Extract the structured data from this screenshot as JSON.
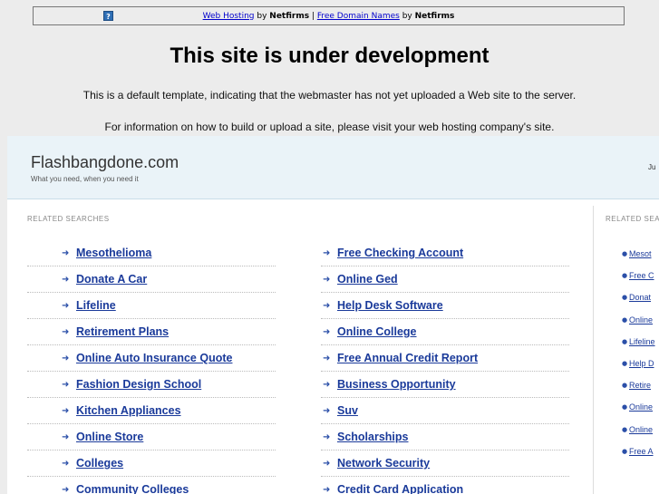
{
  "topbar": {
    "help_icon": "?",
    "link1": "Web Hosting",
    "by1": " by ",
    "brand1": "Netfirms",
    "sep": " | ",
    "link2": "Free Domain Names",
    "by2": " by ",
    "brand2": "Netfirms"
  },
  "title": "This site is under development",
  "line1": "This is a default template, indicating that the webmaster has not yet uploaded a Web site to the server.",
  "line2": "For information on how to build or upload a site, please visit your web hosting company's site.",
  "header": {
    "brand": "Flashbangdone.com",
    "tagline": "What you need, when you need it",
    "right_text": "Ju"
  },
  "related_label": "RELATED SEARCHES",
  "related_label_right": "RELATED SEA",
  "col1": [
    "Mesothelioma",
    "Donate A Car",
    "Lifeline",
    "Retirement Plans",
    "Online Auto Insurance Quote",
    "Fashion Design School",
    "Kitchen Appliances",
    "Online Store",
    "Colleges",
    "Community Colleges"
  ],
  "col2": [
    "Free Checking Account",
    "Online Ged",
    "Help Desk Software",
    "Online College",
    "Free Annual Credit Report",
    "Business Opportunity",
    "Suv",
    "Scholarships",
    "Network Security",
    "Credit Card Application"
  ],
  "right_col": [
    "Mesot",
    "Free C",
    "Donat",
    "Online",
    "Lifeline",
    "Help D",
    "Retire",
    "Online",
    "Online",
    "Free A"
  ],
  "colors": {
    "link": "#1a3a9a",
    "header_bg": "#eaf3f8",
    "page_bg": "#ececec"
  }
}
